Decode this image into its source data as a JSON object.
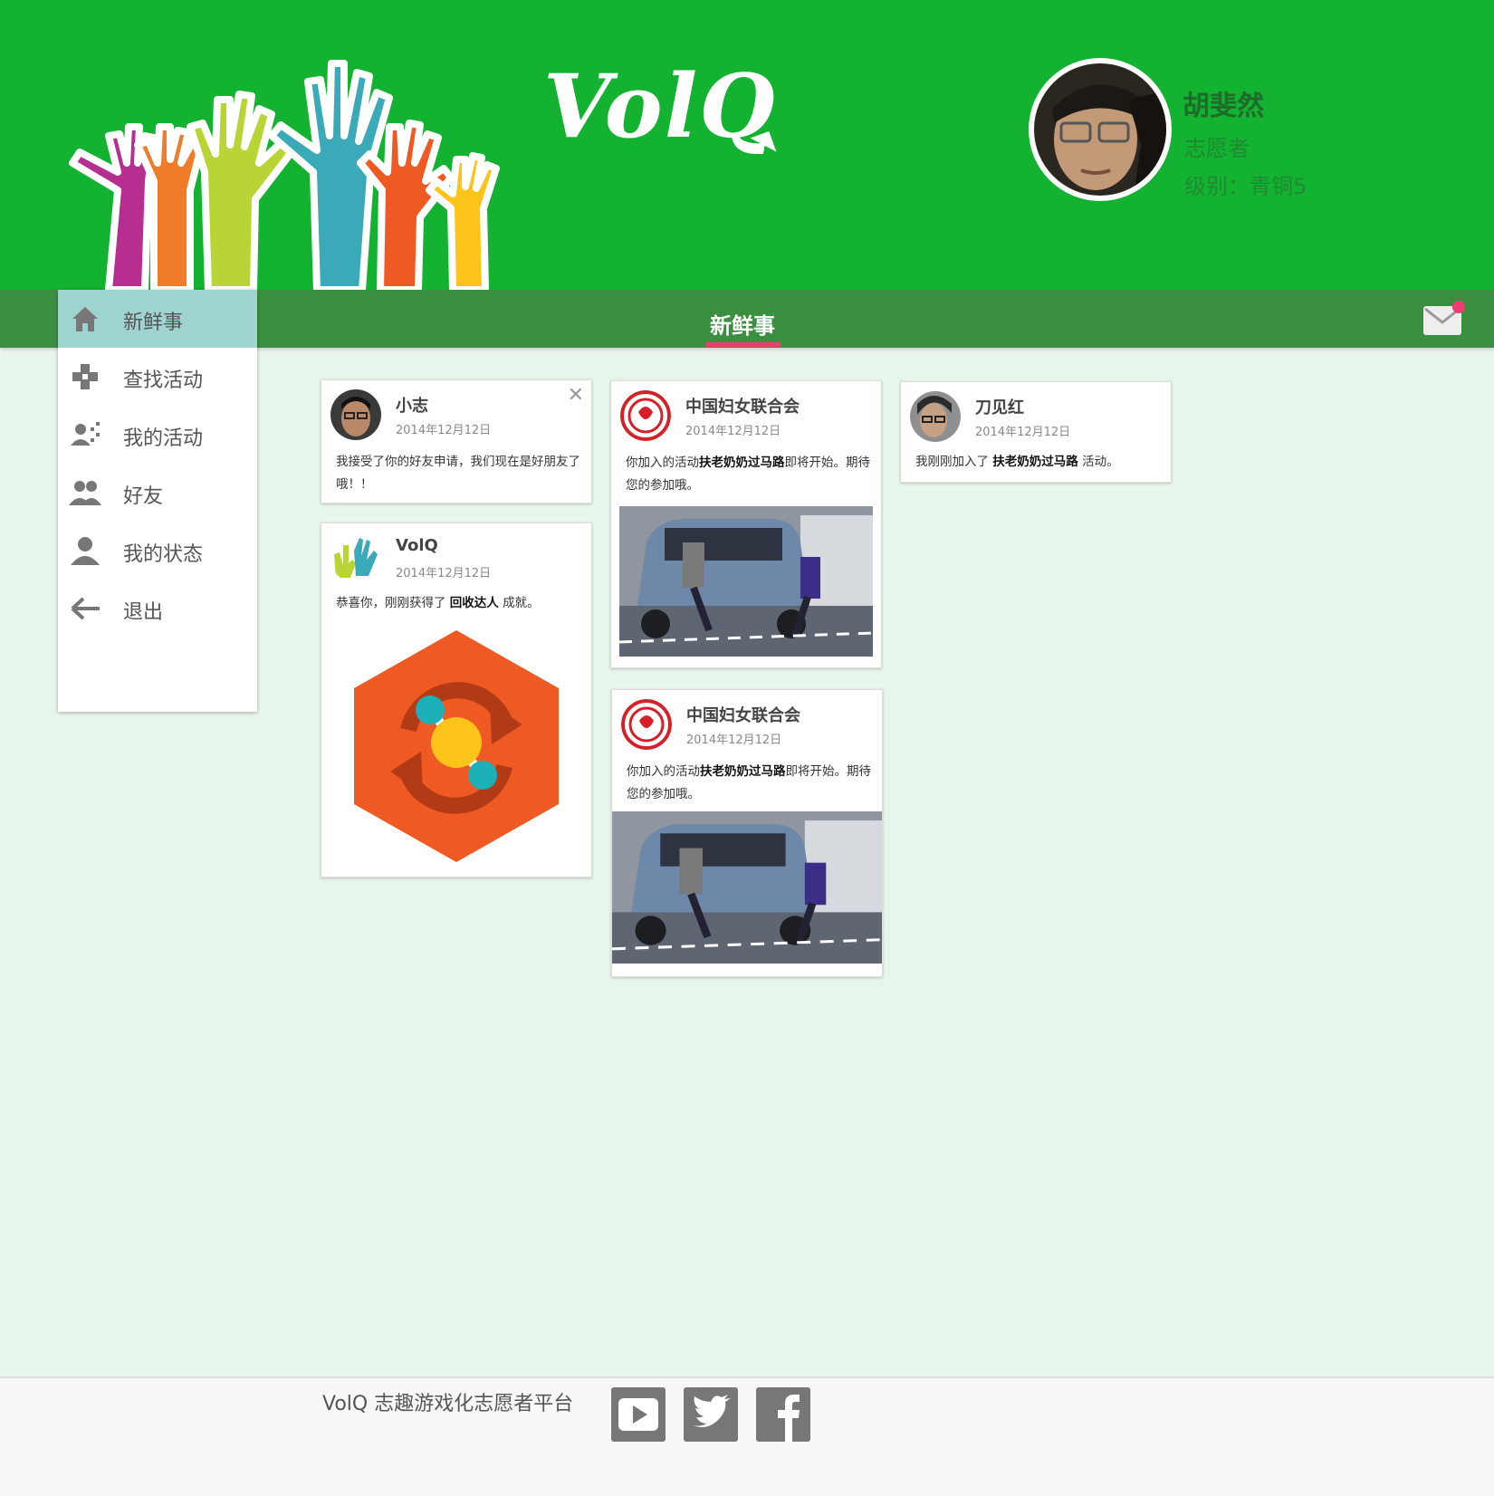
{
  "app": {
    "logo": "VolQ"
  },
  "user": {
    "name": "胡斐然",
    "role": "志愿者",
    "level": "级别：青铜5"
  },
  "nav": {
    "title": "新鲜事",
    "mail_icon": "mail-icon"
  },
  "sidebar": {
    "items": [
      {
        "label": "新鲜事",
        "icon": "home-icon",
        "active": true
      },
      {
        "label": "查找活动",
        "icon": "gamepad-icon"
      },
      {
        "label": "我的活动",
        "icon": "group-activity-icon"
      },
      {
        "label": "好友",
        "icon": "friends-icon"
      },
      {
        "label": "我的状态",
        "icon": "person-icon"
      },
      {
        "label": "退出",
        "icon": "arrow-left-icon"
      }
    ]
  },
  "feed": {
    "cards": [
      {
        "name": "小志",
        "date": "2014年12月12日",
        "text": "我接受了你的好友申请，我们现在是好朋友了哦！！"
      },
      {
        "name": "中国妇女联合会",
        "date": "2014年12月12日",
        "text_pre": "你加入的活动",
        "text_bold": "扶老奶奶过马路",
        "text_post": "即将开始。期待您的参加哦。"
      },
      {
        "name": "刀见红",
        "date": "2014年12月12日",
        "text_pre": "我刚刚加入了 ",
        "text_bold": "扶老奶奶过马路",
        "text_post": " 活动。"
      },
      {
        "name": "VolQ",
        "date": "2014年12月12日",
        "text_pre": "恭喜你，刚刚获得了 ",
        "text_bold": "回收达人",
        "text_post": " 成就。"
      },
      {
        "name": "中国妇女联合会",
        "date": "2014年12月12日",
        "text_pre": "你加入的活动",
        "text_bold": "扶老奶奶过马路",
        "text_post": "即将开始。期待您的参加哦。"
      }
    ]
  },
  "footer": {
    "text": "VolQ 志趣游戏化志愿者平台",
    "social": [
      "youtube-icon",
      "twitter-icon",
      "facebook-icon"
    ]
  },
  "colors": {
    "header": "#13b231",
    "navbar": "#3b8f40",
    "accent": "#ec3e72",
    "sidebar_active": "#9fd3d0",
    "badge": "#ef5a24"
  }
}
